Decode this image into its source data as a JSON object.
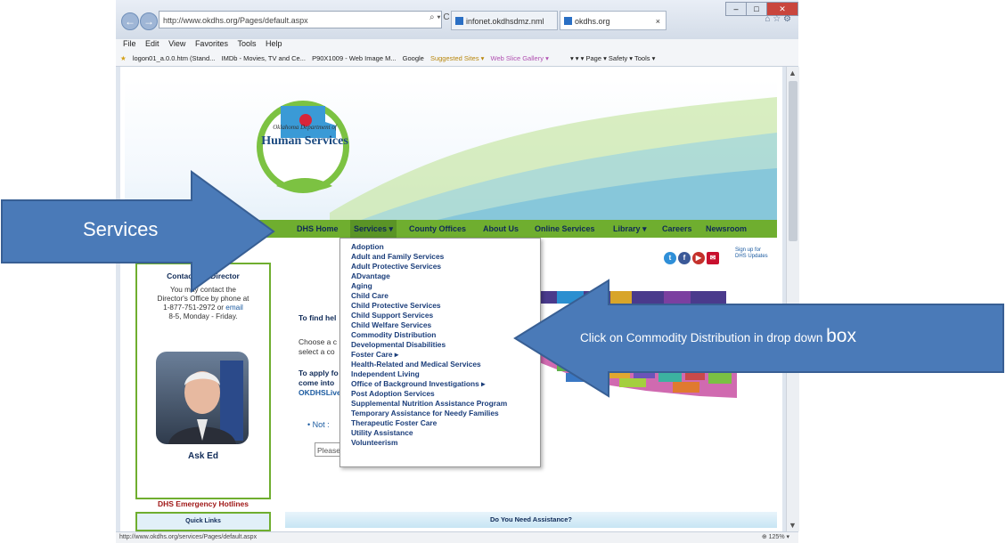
{
  "browser": {
    "address": "http://www.okdhs.org/Pages/default.aspx",
    "address_controls": "⌕ ▾ C",
    "tabs": [
      {
        "label": "infonet.okdhsdmz.nml"
      },
      {
        "label": "okdhs.org",
        "close": "×"
      }
    ],
    "menu": [
      "File",
      "Edit",
      "View",
      "Favorites",
      "Tools",
      "Help"
    ],
    "favorites": [
      "logon01_a.0.0.htm (Stand...",
      "IMDb - Movies, TV and Ce...",
      "P90X1009 - Web Image M...",
      "Google",
      "Suggested Sites ▾",
      "Web Slice Gallery ▾"
    ],
    "commandbar": "▾ ▾ ▾ Page ▾ Safety ▾ Tools ▾",
    "status_url": "http://www.okdhs.org/services/Pages/default.aspx",
    "zoom": "⊕ 125% ▾"
  },
  "logo": {
    "line1": "Oklahoma Department of",
    "line2": "Human Services"
  },
  "topnav": [
    {
      "label": "DHS Home"
    },
    {
      "label": "Services ▾"
    },
    {
      "label": "County Offices"
    },
    {
      "label": "About Us"
    },
    {
      "label": "Online Services"
    },
    {
      "label": "Library ▾"
    },
    {
      "label": "Careers"
    },
    {
      "label": "Newsroom"
    }
  ],
  "services_menu": [
    "Adoption",
    "Adult and Family Services",
    "Adult Protective Services",
    "ADvantage",
    "Aging",
    "Child Care",
    "Child Protective Services",
    "Child Support Services",
    "Child Welfare Services",
    "Commodity Distribution",
    "Developmental Disabilities",
    "Foster Care ▸",
    "Health-Related and Medical Services",
    "Independent Living",
    "Office of Background Investigations ▸",
    "Post Adoption Services",
    "Supplemental Nutrition Assistance Program",
    "Temporary Assistance for Needy Families",
    "Therapeutic Foster Care",
    "Utility Assistance",
    "Volunteerism"
  ],
  "signup": {
    "line1": "Sign up for",
    "line2": "DHS Updates"
  },
  "contact": {
    "title": "Contact the Director",
    "line1": "You may contact the",
    "line2": "Director's Office by phone at",
    "phone": "1-877-751-2972 or ",
    "email": "email",
    "hours": "8-5, Monday - Friday.",
    "ask": "Ask Ed"
  },
  "hotlines": "DHS Emergency Hotlines",
  "quicklinks": "Quick Links",
  "assistance": "Do You Need Assistance?",
  "main": {
    "find_help": "To find hel",
    "choose1": "Choose a c",
    "choose2": "select a co",
    "apply1": "To apply fo",
    "apply2": "come into",
    "apply3": "OKDHSLive",
    "bullet": "• Not :",
    "select_placeholder": "Please"
  },
  "callouts": {
    "services": "Services",
    "commodity_prefix": "Click on Commodity Distribution in drop down ",
    "commodity_suffix": "box"
  },
  "colors": {
    "nav_green": "#6fae2f",
    "callout_blue": "#4a7ab8",
    "link_blue": "#1a5aa0",
    "emergency_red": "#a01818"
  }
}
